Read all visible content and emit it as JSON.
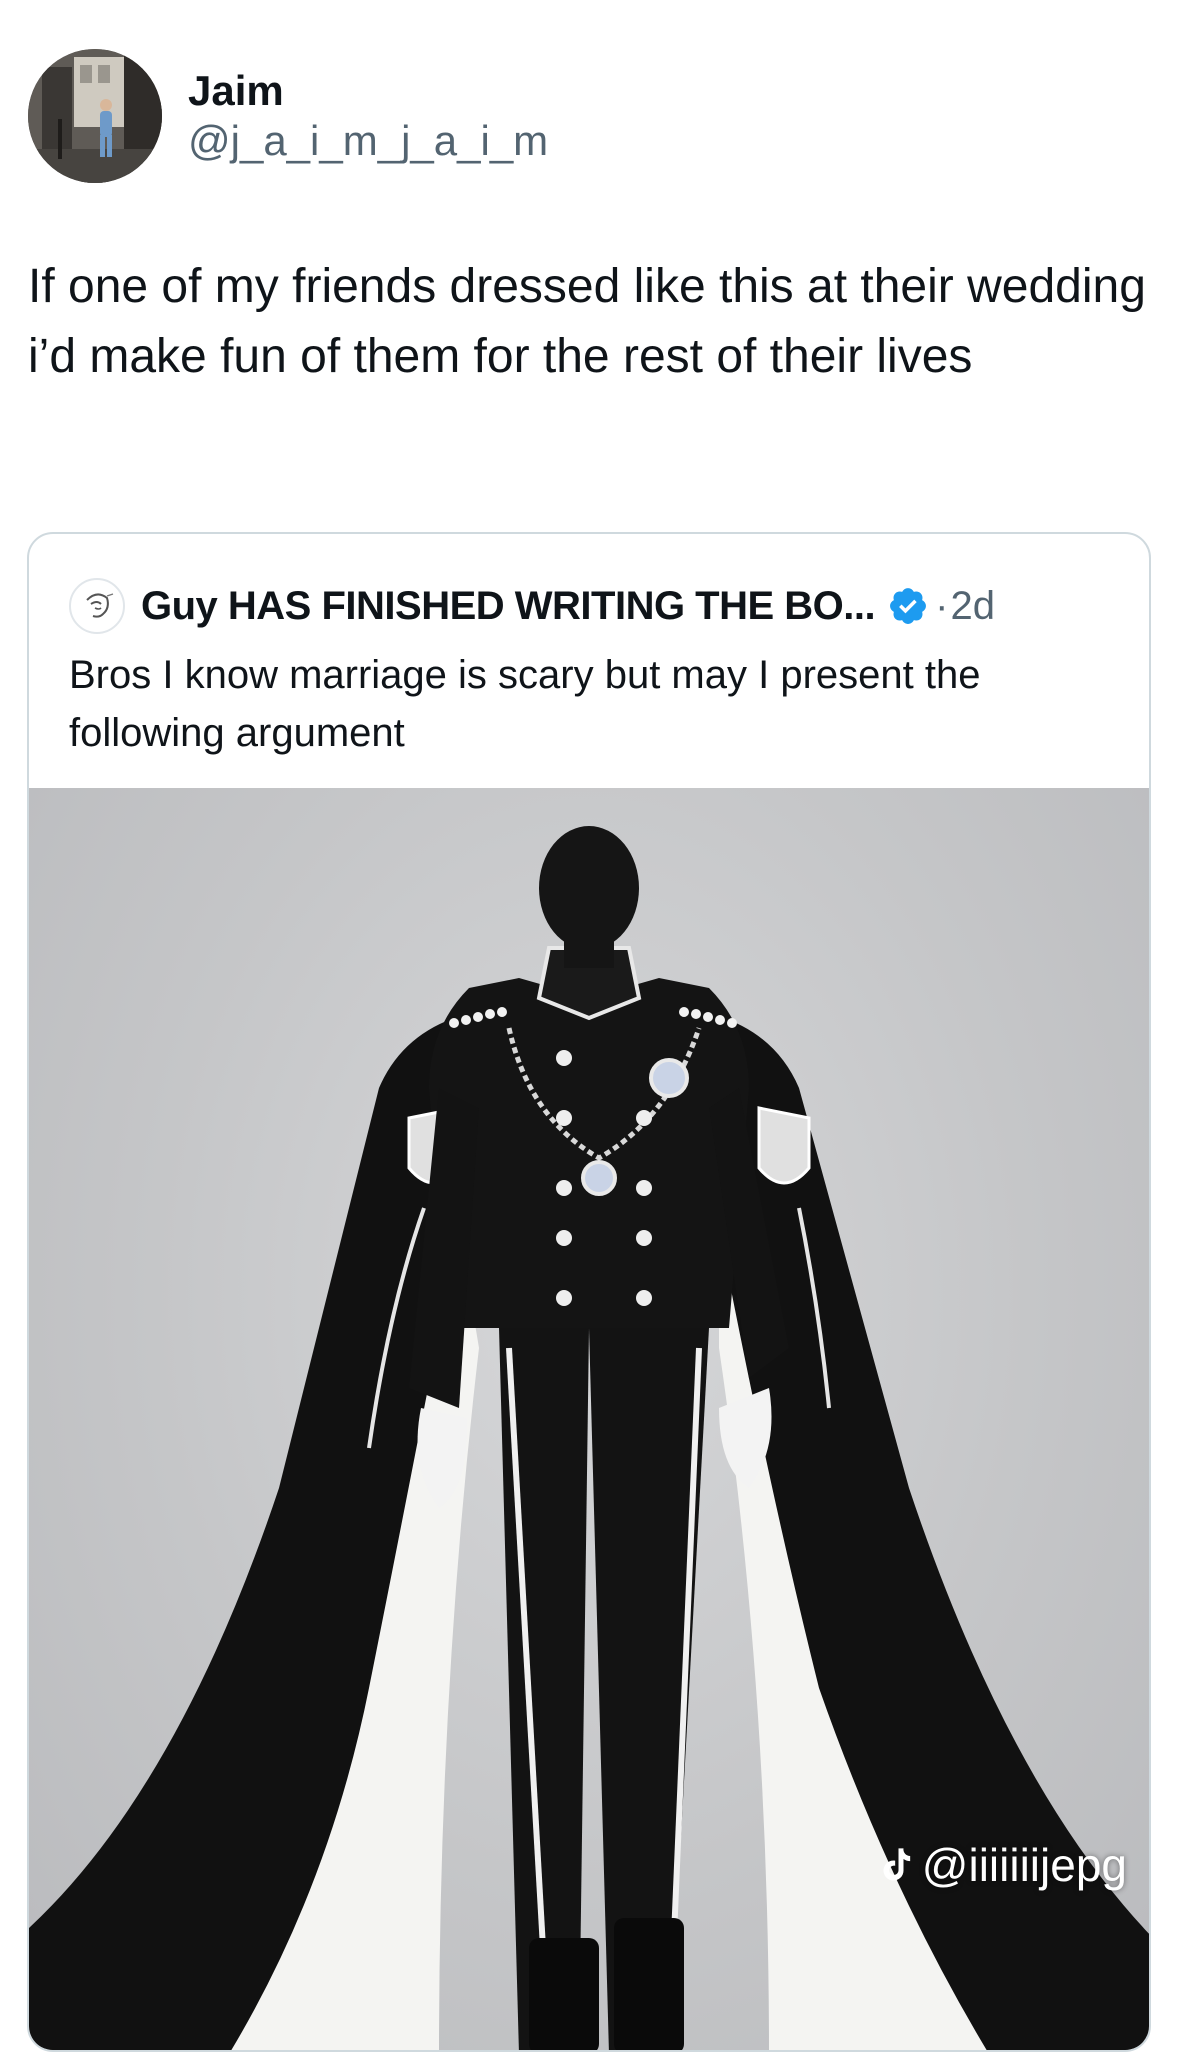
{
  "author": {
    "display_name": "Jaim",
    "handle": "@j_a_i_m_j_a_i_m",
    "avatar_icon": "profile-photo"
  },
  "tweet": {
    "text": "If one of my friends dressed like this at their wedding i’d make fun of them for the rest of their lives"
  },
  "quoted_tweet": {
    "author_name": "Guy HAS FINISHED WRITING THE BO...",
    "verified_icon": "verified-badge-icon",
    "separator": "·",
    "time_ago": "2d",
    "text": "Bros I know marriage is scary but may I present the following argument",
    "media": {
      "description_icon": "mannequin-wedding-suit-image",
      "watermark": "@iiiiiiijepg",
      "watermark_icon": "tiktok-icon"
    }
  },
  "colors": {
    "text_primary": "#0f1419",
    "text_secondary": "#536471",
    "card_border": "#cfd9de",
    "verified_blue": "#1d9bf0",
    "background": "#ffffff"
  }
}
